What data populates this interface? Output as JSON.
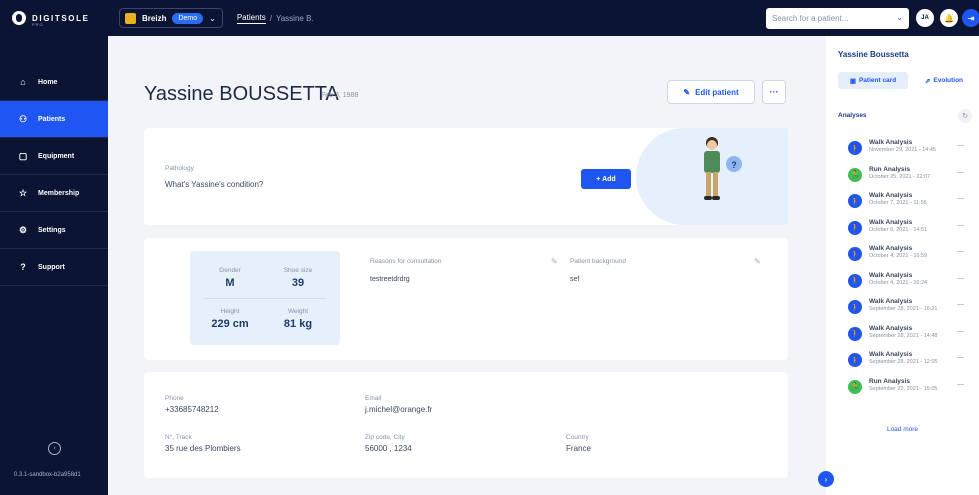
{
  "topbar": {
    "logo_text": "DIGITSOLE",
    "logo_sub": "PRO",
    "org_name": "Breizh",
    "org_badge": "Demo",
    "breadcrumb": {
      "link": "Patients",
      "sep": "/",
      "current": "Yassine B."
    },
    "search_placeholder": "Search for a patient...",
    "avatar_initials": "JA"
  },
  "sidebar": {
    "items": [
      {
        "label": "Home",
        "icon": "home-icon",
        "glyph": "⌂"
      },
      {
        "label": "Patients",
        "icon": "patients-icon",
        "glyph": "👥"
      },
      {
        "label": "Equipment",
        "icon": "equipment-icon",
        "glyph": "▢"
      },
      {
        "label": "Membership",
        "icon": "membership-icon",
        "glyph": "☆"
      },
      {
        "label": "Settings",
        "icon": "settings-icon",
        "glyph": "⚙"
      },
      {
        "label": "Support",
        "icon": "support-icon",
        "glyph": "?"
      }
    ],
    "active": "Patients",
    "version": "0.3.1-sandbox-b2a958d1"
  },
  "patient": {
    "name": "Yassine BOUSSETTA",
    "dob": "Feb 3, 1988",
    "edit_label": "Edit patient",
    "more_label": "···"
  },
  "pathology": {
    "label": "Pathology",
    "prompt": "What's Yassine's condition?",
    "add_label": "+ Add"
  },
  "stats": {
    "gender_label": "Gender",
    "gender": "M",
    "shoe_label": "Shoe size",
    "shoe": "39",
    "height_label": "Height",
    "height": "229 cm",
    "weight_label": "Weight",
    "weight": "81 kg"
  },
  "consultation": {
    "reasons_label": "Reasons for consultation",
    "reasons": "testreetdrdrg",
    "background_label": "Patient background",
    "background": "sef"
  },
  "contact": {
    "phone_label": "Phone",
    "phone": "+33685748212",
    "email_label": "Email",
    "email": "j.michel@orange.fr",
    "address_label": "N°, Track",
    "address": "35 rue des Plombiers",
    "zip_label": "Zip code, City",
    "zip": "56000 , 1234",
    "country_label": "Country",
    "country": "France"
  },
  "right_panel": {
    "name": "Yassine Boussetta",
    "tabs": [
      {
        "label": "Patient card",
        "icon": "card-icon"
      },
      {
        "label": "Evolution",
        "icon": "evolution-icon"
      }
    ],
    "analyses_title": "Analyses",
    "load_more": "Load more",
    "analyses": [
      {
        "name": "Walk Analysis",
        "date": "November 29, 2021 - 14:45",
        "type": "walk"
      },
      {
        "name": "Run Analysis",
        "date": "October 25, 2021 - 22:07",
        "type": "run"
      },
      {
        "name": "Walk Analysis",
        "date": "October 7, 2021 - 11:56",
        "type": "walk"
      },
      {
        "name": "Walk Analysis",
        "date": "October 6, 2021 - 14:51",
        "type": "walk"
      },
      {
        "name": "Walk Analysis",
        "date": "October 4, 2021 - 16:59",
        "type": "walk"
      },
      {
        "name": "Walk Analysis",
        "date": "October 4, 2021 - 16:24",
        "type": "walk"
      },
      {
        "name": "Walk Analysis",
        "date": "September 28, 2021 - 16:21",
        "type": "walk"
      },
      {
        "name": "Walk Analysis",
        "date": "September 28, 2021 - 14:48",
        "type": "walk"
      },
      {
        "name": "Walk Analysis",
        "date": "September 28, 2021 - 12:05",
        "type": "walk"
      },
      {
        "name": "Run Analysis",
        "date": "September 22, 2021 - 15:05",
        "type": "run"
      }
    ]
  },
  "colors": {
    "walk": "#1f56f2",
    "run": "#3fbf52",
    "accent": "#1f56f2",
    "nav_bg": "#0b1533"
  }
}
